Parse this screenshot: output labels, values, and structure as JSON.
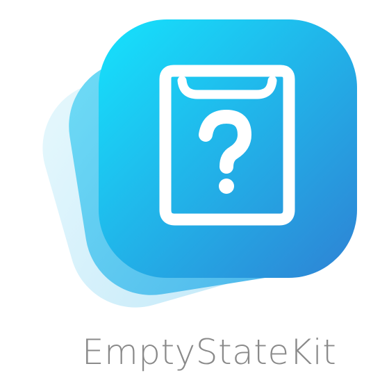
{
  "brand": {
    "name": "EmptyStateKit",
    "icon": "clipboard-question-icon",
    "colors": {
      "gradient_start": "#17e0fb",
      "gradient_end": "#2c86d6",
      "layer_mid": "#58cdf2",
      "layer_back": "#cdeefa",
      "wordmark": "#8a8a8a",
      "glyph": "#ffffff"
    }
  }
}
